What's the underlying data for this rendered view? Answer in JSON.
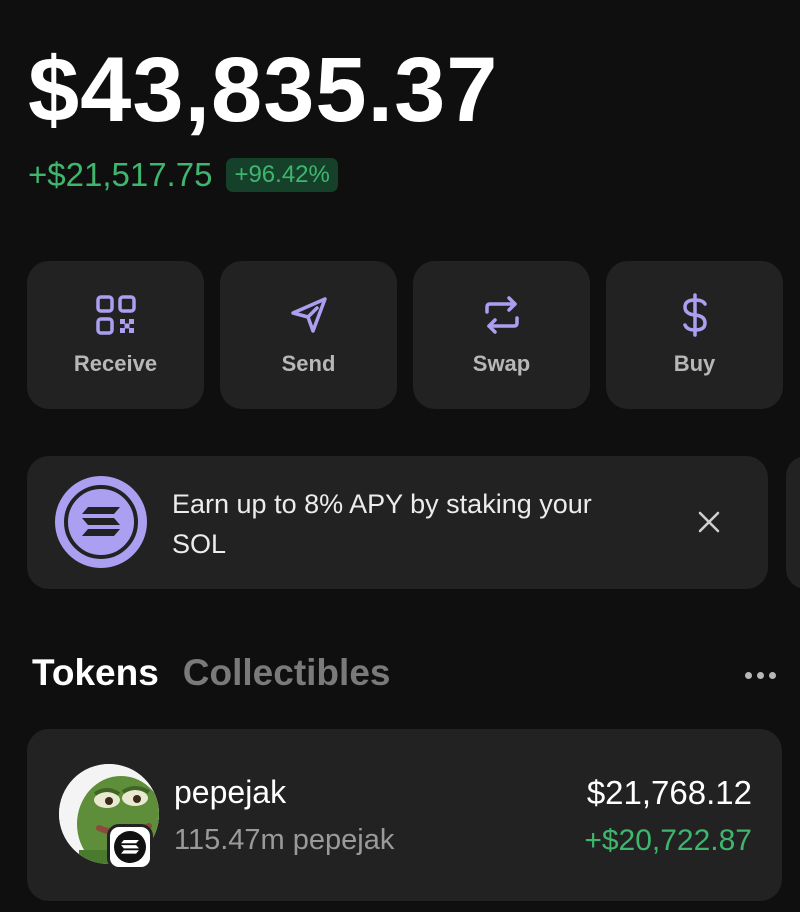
{
  "balance": {
    "total": "$43,835.37",
    "change_amount": "+$21,517.75",
    "change_percent": "+96.42%"
  },
  "actions": [
    {
      "label": "Receive",
      "icon": "qr-code-icon"
    },
    {
      "label": "Send",
      "icon": "send-icon"
    },
    {
      "label": "Swap",
      "icon": "swap-icon"
    },
    {
      "label": "Buy",
      "icon": "dollar-icon"
    }
  ],
  "banner": {
    "text": "Earn up to 8% APY by staking your SOL",
    "icon": "solana-icon",
    "close_icon": "close-icon"
  },
  "tabs": {
    "active": "Tokens",
    "inactive": "Collectibles"
  },
  "tokens": [
    {
      "name": "pepejak",
      "amount": "115.47m pepejak",
      "value": "$21,768.12",
      "change": "+$20,722.87"
    }
  ],
  "colors": {
    "background": "#0f0f0f",
    "card": "#222222",
    "positive": "#3fb66d",
    "accent": "#ab9ff2"
  }
}
